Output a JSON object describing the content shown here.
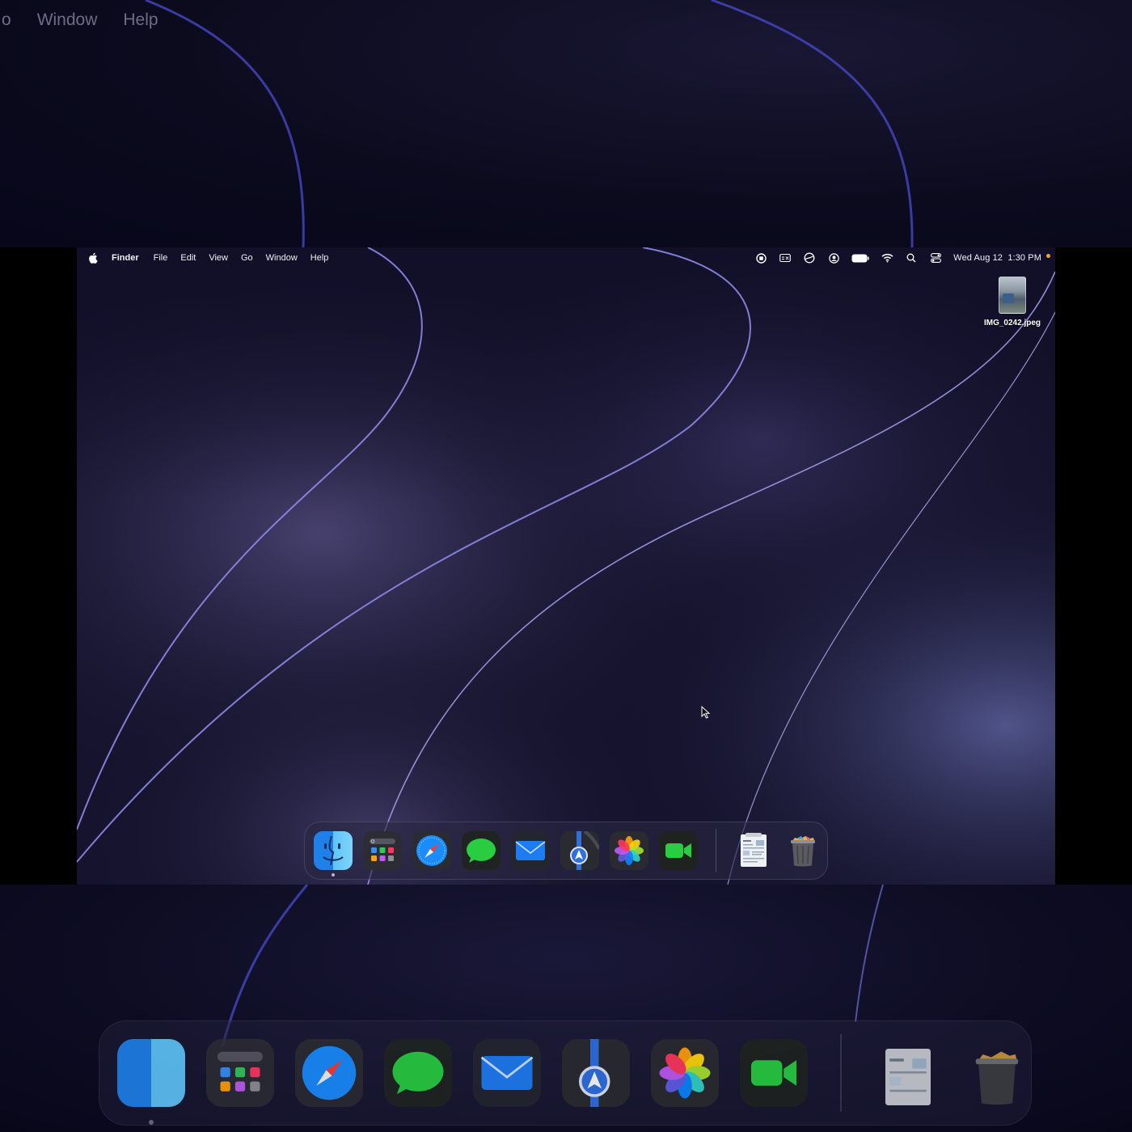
{
  "zoomed_menu": {
    "items": [
      "o",
      "Window",
      "Help"
    ]
  },
  "menubar": {
    "app_name": "Finder",
    "items": [
      "File",
      "Edit",
      "View",
      "Go",
      "Window",
      "Help"
    ],
    "clock_date": "Wed Aug 12",
    "clock_time": "1:30 PM",
    "status_icons": [
      "screen-record-icon",
      "caption-icon",
      "vpn-icon",
      "user-icon",
      "battery-icon",
      "wifi-icon",
      "spotlight-search-icon",
      "control-center-icon"
    ]
  },
  "desktop": {
    "file_name": "IMG_0242.jpeg"
  },
  "dock": {
    "apps": [
      {
        "name": "Finder",
        "icon": "finder-icon",
        "running": true
      },
      {
        "name": "Launchpad",
        "icon": "launchpad-icon",
        "running": false
      },
      {
        "name": "Safari",
        "icon": "safari-icon",
        "running": false
      },
      {
        "name": "Messages",
        "icon": "messages-icon",
        "running": false
      },
      {
        "name": "Mail",
        "icon": "mail-icon",
        "running": false
      },
      {
        "name": "Maps",
        "icon": "maps-icon",
        "running": false
      },
      {
        "name": "Photos",
        "icon": "photos-icon",
        "running": false
      },
      {
        "name": "FaceTime",
        "icon": "facetime-icon",
        "running": false
      }
    ],
    "extras": [
      {
        "name": "Document",
        "icon": "document-preview-icon"
      },
      {
        "name": "Trash",
        "icon": "trash-icon"
      }
    ]
  },
  "colors": {
    "wallpaper_base": "#15132d",
    "wallpaper_highlight": "#4d4676",
    "wave_line": "#8f8ae8",
    "accent_dot": "#f5a623"
  }
}
